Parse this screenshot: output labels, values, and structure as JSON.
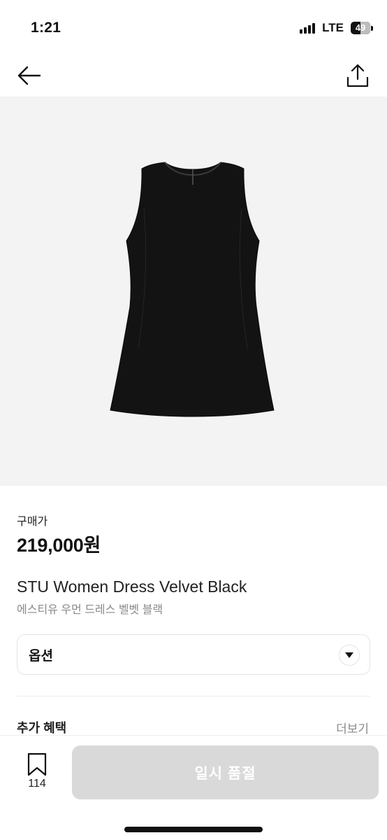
{
  "status_bar": {
    "time": "1:21",
    "network": "LTE",
    "battery": "49",
    "battery_level": 0.49
  },
  "nav": {
    "back_icon": "arrow-left-icon",
    "share_icon": "share-upload-icon"
  },
  "product": {
    "image_alt": "black sleeveless mini dress",
    "price_label": "구매가",
    "price": "219,000원",
    "name": "STU Women Dress Velvet Black",
    "subname": "에스티유 우먼 드레스 벨벳 블랙"
  },
  "option": {
    "label": "옵션",
    "arrow_icon": "chevron-down-icon"
  },
  "benefits": {
    "title": "추가 혜택",
    "more": "더보기"
  },
  "bottom": {
    "bookmark_icon": "bookmark-icon",
    "bookmark_count": "114",
    "buy_label": "일시 품절"
  },
  "colors": {
    "image_bg": "#f3f3f3",
    "disabled_button": "#d9d9d9",
    "muted_text": "#8a8a8a"
  }
}
